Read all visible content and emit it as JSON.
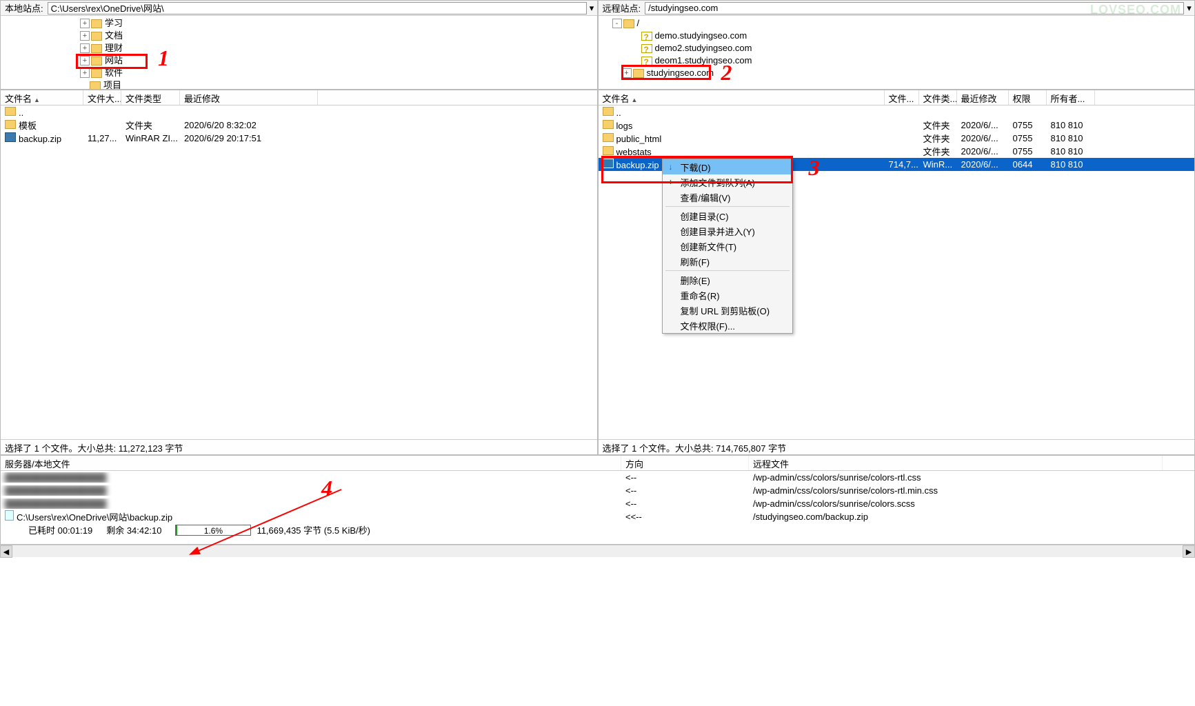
{
  "watermark": "LOVSEO.COM",
  "local": {
    "path_label": "本地站点:",
    "path_value": "C:\\Users\\rex\\OneDrive\\网站\\",
    "tree": [
      {
        "indent": 115,
        "exp": "+",
        "style": "folder",
        "label": "学习"
      },
      {
        "indent": 115,
        "exp": "+",
        "style": "folder",
        "label": "文档"
      },
      {
        "indent": 115,
        "exp": "+",
        "style": "folder",
        "label": "理财"
      },
      {
        "indent": 115,
        "exp": "+",
        "style": "folder",
        "label": "网站",
        "boxed": true
      },
      {
        "indent": 115,
        "exp": "+",
        "style": "folder",
        "label": "软件"
      },
      {
        "indent": 115,
        "exp": "",
        "style": "folder",
        "label": "项目"
      }
    ],
    "list_headers": [
      "文件名",
      "文件大...",
      "文件类型",
      "最近修改"
    ],
    "list": [
      {
        "icon": "updir",
        "name": "..",
        "size": "",
        "type": "",
        "date": ""
      },
      {
        "icon": "folder",
        "name": "模板",
        "size": "",
        "type": "文件夹",
        "date": "2020/6/20 8:32:02"
      },
      {
        "icon": "zip",
        "name": "backup.zip",
        "size": "11,27...",
        "type": "WinRAR ZI...",
        "date": "2020/6/29 20:17:51"
      }
    ],
    "status": "选择了 1 个文件。大小总共: 11,272,123 字节"
  },
  "remote": {
    "path_label": "远程站点:",
    "path_value": "/studyingseo.com",
    "tree": [
      {
        "indent": 20,
        "exp": "-",
        "style": "folder",
        "label": "/"
      },
      {
        "indent": 48,
        "exp": "",
        "style": "unknown",
        "label": "demo.studyingseo.com"
      },
      {
        "indent": 48,
        "exp": "",
        "style": "unknown",
        "label": "demo2.studyingseo.com"
      },
      {
        "indent": 48,
        "exp": "",
        "style": "unknown",
        "label": "deom1.studyingseo.com"
      },
      {
        "indent": 34,
        "exp": "+",
        "style": "folder",
        "label": "studyingseo.com",
        "boxed": true
      }
    ],
    "list_headers": [
      "文件名",
      "文件...",
      "文件类...",
      "最近修改",
      "权限",
      "所有者..."
    ],
    "list": [
      {
        "icon": "updir",
        "name": "..",
        "size": "",
        "type": "",
        "date": "",
        "perm": "",
        "owner": ""
      },
      {
        "icon": "folder",
        "name": "logs",
        "size": "",
        "type": "文件夹",
        "date": "2020/6/...",
        "perm": "0755",
        "owner": "810 810"
      },
      {
        "icon": "folder",
        "name": "public_html",
        "size": "",
        "type": "文件夹",
        "date": "2020/6/...",
        "perm": "0755",
        "owner": "810 810"
      },
      {
        "icon": "folder",
        "name": "webstats",
        "size": "",
        "type": "文件夹",
        "date": "2020/6/...",
        "perm": "0755",
        "owner": "810 810"
      },
      {
        "icon": "zip",
        "name": "backup.zip",
        "size": "714,7...",
        "type": "WinR...",
        "date": "2020/6/...",
        "perm": "0644",
        "owner": "810 810",
        "selected": true,
        "boxed": true
      }
    ],
    "status": "选择了 1 个文件。大小总共: 714,765,807 字节",
    "context_menu": [
      {
        "label": "下载(D)",
        "icon": "↓",
        "highlight": true
      },
      {
        "label": "添加文件到队列(A)",
        "icon": "+"
      },
      {
        "label": "查看/编辑(V)"
      },
      {
        "sep": true
      },
      {
        "label": "创建目录(C)"
      },
      {
        "label": "创建目录并进入(Y)"
      },
      {
        "label": "创建新文件(T)"
      },
      {
        "label": "刷新(F)"
      },
      {
        "sep": true
      },
      {
        "label": "删除(E)"
      },
      {
        "label": "重命名(R)"
      },
      {
        "label": "复制 URL 到剪贴板(O)"
      },
      {
        "label": "文件权限(F)..."
      }
    ]
  },
  "queue": {
    "headers": [
      "服务器/本地文件",
      "方向",
      "远程文件"
    ],
    "rows": [
      {
        "local": "████████████████",
        "dir": "<--",
        "remote": "/wp-admin/css/colors/sunrise/colors-rtl.css",
        "blur": true
      },
      {
        "local": "████████████████",
        "dir": "<--",
        "remote": "/wp-admin/css/colors/sunrise/colors-rtl.min.css",
        "blur": true
      },
      {
        "local": "████████████████",
        "dir": "<--",
        "remote": "/wp-admin/css/colors/sunrise/colors.scss",
        "blur": true
      },
      {
        "local": "C:\\Users\\rex\\OneDrive\\网站\\backup.zip",
        "dir": "<<--",
        "remote": "/studyingseo.com/backup.zip",
        "blur": false,
        "page_icon": true
      }
    ],
    "progress": {
      "elapsed_label": "已耗时 00:01:19",
      "remaining_label": "剩余 34:42:10",
      "percent": "1.6%",
      "percent_num": 1.6,
      "bytes": "11,669,435 字节 (5.5 KiB/秒)"
    }
  },
  "annotations": {
    "n1": "1",
    "n2": "2",
    "n3": "3",
    "n4": "4"
  }
}
